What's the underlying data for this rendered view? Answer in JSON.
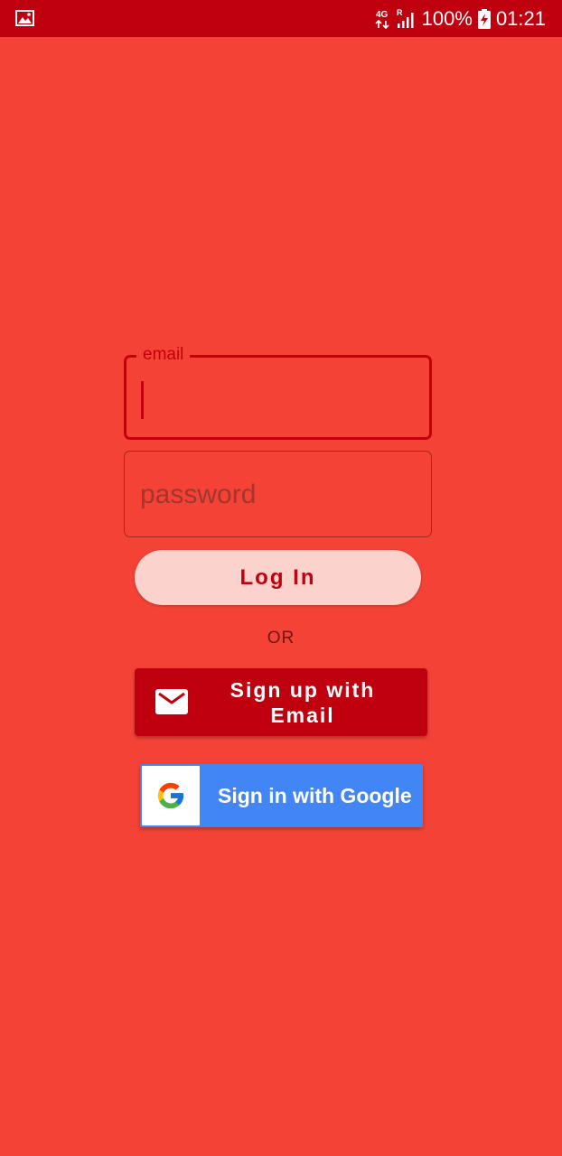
{
  "status_bar": {
    "network": "4G",
    "roaming": "R",
    "battery": "100%",
    "time": "01:21",
    "icons": [
      "gallery-icon",
      "network-4g-icon",
      "signal-icon",
      "battery-charging-icon"
    ]
  },
  "login_form": {
    "email_label": "email",
    "email_value": "",
    "password_placeholder": "password",
    "password_value": "",
    "login_label": "Log In"
  },
  "separator_text": "OR",
  "email_signup": {
    "label": "Sign up with Email",
    "icon": "mail-icon"
  },
  "google_signin": {
    "label": "Sign in with Google",
    "icon": "google-logo-icon"
  },
  "colors": {
    "background": "#f44336",
    "status_bar": "#bf000f",
    "accent": "#c4000d",
    "login_button": "#fcd2cd",
    "email_button": "#bf000f",
    "google_blue": "#4285f4"
  }
}
